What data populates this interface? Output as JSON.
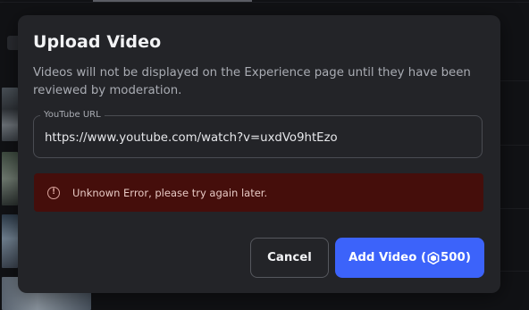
{
  "dialog": {
    "title": "Upload Video",
    "description": "Videos will not be displayed on the Experience page until they have been reviewed by moderation.",
    "url_field": {
      "label": "YouTube URL",
      "value": "https://www.youtube.com/watch?v=uxdVo9htEzo"
    },
    "error": {
      "icon": "error-icon",
      "message": "Unknown Error, please try again later."
    },
    "buttons": {
      "cancel_label": "Cancel",
      "add_label_prefix": "Add Video (",
      "add_cost": "500",
      "add_label_suffix": ")",
      "cost_icon": "robux-icon"
    }
  },
  "colors": {
    "dialog_bg": "#232428",
    "error_bg": "#450e0b",
    "primary_button": "#3c63fa",
    "overlay_bg": "#111215"
  }
}
